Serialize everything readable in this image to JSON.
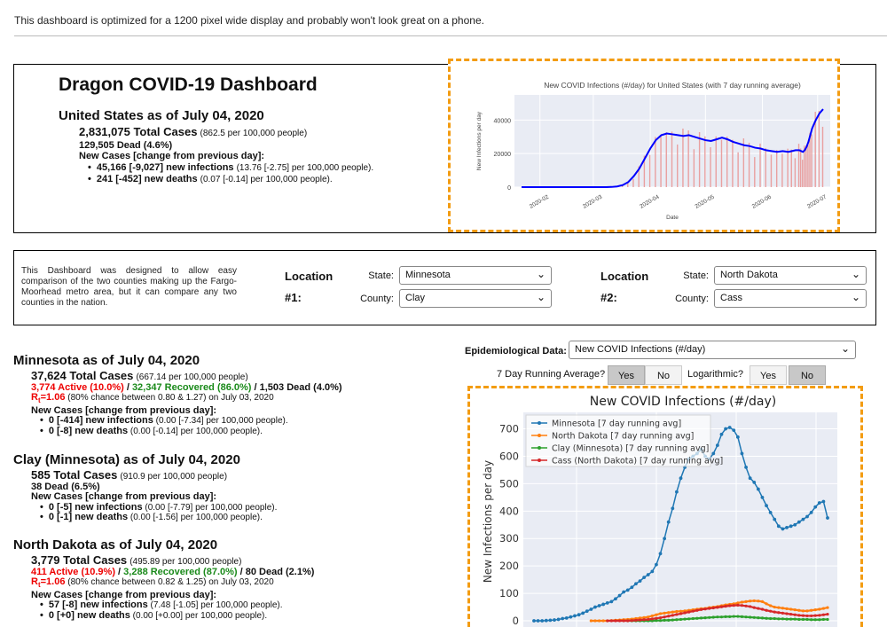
{
  "notice": "This dashboard is optimized for a 1200 pixel wide display and probably won't look great on a phone.",
  "header": {
    "title": "Dragon COVID-19 Dashboard",
    "us_title": "United States as of July 04, 2020",
    "total_cases": "2,831,075 Total Cases",
    "total_cases_rate": "(862.5 per 100,000 people)",
    "dead": "129,505 Dead (4.6%)",
    "new_cases_heading": "New Cases [change from previous day]:",
    "infections_bold": "45,166 [-9,027] new infections",
    "infections_rate": "(13.76 [-2.75] per 100,000 people).",
    "deaths_bold": "241 [-452] new deaths",
    "deaths_rate": "(0.07 [-0.14] per 100,000 people)."
  },
  "us_chart": {
    "title": "New COVID Infections (#/day) for United States (with 7 day running average)",
    "ylabel": "New Infections per day",
    "xlabel": "Date",
    "yticks": [
      "0",
      "20000",
      "40000"
    ],
    "xticks": [
      "2020-02",
      "2020-03",
      "2020-04",
      "2020-05",
      "2020-06",
      "2020-07"
    ]
  },
  "location": {
    "description": "This Dashboard was designed to allow easy comparison of the two counties making up the Fargo-Moorhead metro area, but it can compare any two counties in the nation.",
    "loc1_word": "Location",
    "loc1_num": "#1:",
    "loc2_word": "Location",
    "loc2_num": "#2:",
    "state_label": "State:",
    "county_label": "County:",
    "state1": "Minnesota",
    "county1": "Clay",
    "state2": "North Dakota",
    "county2": "Cass"
  },
  "regions": {
    "mn": {
      "title": "Minnesota as of July 04, 2020",
      "total": "37,624 Total Cases",
      "total_rate": "(667.14 per 100,000 people)",
      "active": "3,774 Active (10.0%)",
      "sep1": " / ",
      "recovered": "32,347 Recovered (86.0%)",
      "dead": " / 1,503 Dead (4.0%)",
      "rt_label": "R",
      "rt_sub": "t",
      "rt_val": "=1.06",
      "rt_desc": " (80% chance between 0.80 & 1.27) on July 03, 2020",
      "new_heading": "New Cases [change from previous day]:",
      "inf_bold": "0 [-414] new infections",
      "inf_rate": " (0.00 [-7.34] per 100,000 people).",
      "death_bold": "0 [-8] new deaths",
      "death_rate": " (0.00 [-0.14] per 100,000 people)."
    },
    "clay": {
      "title": "Clay (Minnesota) as of July 04, 2020",
      "total": "585 Total Cases",
      "total_rate": "(910.9 per 100,000 people)",
      "dead": "38 Dead (6.5%)",
      "new_heading": "New Cases [change from previous day]:",
      "inf_bold": "0 [-5] new infections",
      "inf_rate": " (0.00 [-7.79] per 100,000 people).",
      "death_bold": "0 [-1] new deaths",
      "death_rate": " (0.00 [-1.56] per 100,000 people)."
    },
    "nd": {
      "title": "North Dakota as of July 04, 2020",
      "total": "3,779 Total Cases",
      "total_rate": "(495.89 per 100,000 people)",
      "active": "411 Active (10.9%)",
      "sep1": " / ",
      "recovered": "3,288 Recovered (87.0%)",
      "dead": " / 80 Dead (2.1%)",
      "rt_label": "R",
      "rt_sub": "t",
      "rt_val": "=1.06",
      "rt_desc": " (80% chance between 0.82 & 1.25) on July 03, 2020",
      "new_heading": "New Cases [change from previous day]:",
      "inf_bold": "57 [-8] new infections",
      "inf_rate": " (7.48 [-1.05] per 100,000 people).",
      "death_bold": "0 [+0] new deaths",
      "death_rate": " (0.00 [+0.00] per 100,000 people)."
    }
  },
  "controls": {
    "epi_label": "Epidemiological Data:",
    "epi_value": "New COVID Infections (#/day)",
    "running_avg_label": "7 Day Running Average?",
    "log_label": "Logarithmic?",
    "yes": "Yes",
    "no": "No"
  },
  "colors": {
    "accent_border": "#f39c12",
    "mn": "#1f77b4",
    "nd": "#ff7f0e",
    "clay": "#2ca02c",
    "cass": "#d62728"
  },
  "chart_data": [
    {
      "type": "bar",
      "title": "New COVID Infections (#/day) for United States (with 7 day running average)",
      "xlabel": "Date",
      "ylabel": "New Infections per day",
      "ylim": [
        0,
        55000
      ],
      "x_range": [
        "2020-01-22",
        "2020-07-04"
      ],
      "series": [
        {
          "type": "line",
          "values": [
            0,
            0,
            0,
            0,
            0,
            0,
            0,
            10,
            30,
            100,
            400,
            1200,
            3000,
            6500,
            11000,
            17000,
            23000,
            28000,
            31000,
            32000,
            31500,
            31000,
            30500,
            31000,
            30000,
            29000,
            28000,
            27500,
            28500,
            29500,
            28500,
            27000,
            26000,
            25000,
            24500,
            23500,
            23000,
            22000,
            21500,
            21000,
            21500,
            21000,
            21500,
            22000,
            22000,
            21500,
            21000,
            22000,
            24000,
            27000,
            31000,
            35000,
            40000,
            44000,
            46500
          ],
          "x": [
            "2020-01-22",
            "2020-01-29",
            "2020-02-05",
            "2020-02-12",
            "2020-02-19",
            "2020-02-26",
            "2020-03-01",
            "2020-03-05",
            "2020-03-08",
            "2020-03-11",
            "2020-03-14",
            "2020-03-17",
            "2020-03-20",
            "2020-03-23",
            "2020-03-26",
            "2020-03-29",
            "2020-04-01",
            "2020-04-04",
            "2020-04-07",
            "2020-04-10",
            "2020-04-13",
            "2020-04-16",
            "2020-04-19",
            "2020-04-22",
            "2020-04-25",
            "2020-04-28",
            "2020-05-01",
            "2020-05-04",
            "2020-05-07",
            "2020-05-10",
            "2020-05-13",
            "2020-05-16",
            "2020-05-19",
            "2020-05-22",
            "2020-05-25",
            "2020-05-28",
            "2020-05-31",
            "2020-06-03",
            "2020-06-06",
            "2020-06-09",
            "2020-06-12",
            "2020-06-15",
            "2020-06-17",
            "2020-06-19",
            "2020-06-21",
            "2020-06-22",
            "2020-06-23",
            "2020-06-24",
            "2020-06-25",
            "2020-06-26",
            "2020-06-27",
            "2020-06-28",
            "2020-06-30",
            "2020-07-02",
            "2020-07-04"
          ]
        }
      ]
    },
    {
      "type": "line",
      "title": "New COVID Infections (#/day)",
      "ylabel": "New Infections per day",
      "ylim": [
        0,
        760
      ],
      "yticks": [
        0,
        100,
        200,
        300,
        400,
        500,
        600,
        700
      ],
      "legend": "top-left",
      "series": [
        {
          "name": "Minnesota [7 day running avg]",
          "values": [
            0,
            0,
            0,
            1,
            2,
            3,
            5,
            8,
            10,
            14,
            18,
            22,
            28,
            35,
            42,
            50,
            55,
            60,
            65,
            70,
            80,
            92,
            105,
            112,
            122,
            135,
            145,
            158,
            168,
            180,
            205,
            245,
            300,
            360,
            410,
            470,
            520,
            560,
            590,
            600,
            610,
            625,
            600,
            590,
            610,
            640,
            680,
            700,
            705,
            695,
            670,
            610,
            560,
            520,
            505,
            480,
            450,
            420,
            395,
            370,
            345,
            335,
            340,
            345,
            350,
            360,
            370,
            380,
            395,
            415,
            430,
            435,
            375
          ]
        },
        {
          "name": "North Dakota [7 day running avg]",
          "values": [
            0,
            0,
            0,
            0,
            0,
            1,
            2,
            3,
            4,
            5,
            6,
            8,
            10,
            12,
            14,
            18,
            22,
            26,
            28,
            30,
            32,
            34,
            35,
            36,
            38,
            40,
            42,
            44,
            45,
            48,
            50,
            52,
            55,
            58,
            60,
            62,
            65,
            68,
            70,
            72,
            73,
            72,
            70,
            62,
            55,
            50,
            48,
            46,
            44,
            42,
            40,
            38,
            36,
            36,
            38,
            40,
            42,
            45,
            48
          ]
        },
        {
          "name": "Clay (Minnesota) [7 day running avg]",
          "values": [
            0,
            0,
            0,
            0,
            0,
            0,
            0,
            1,
            1,
            2,
            2,
            3,
            4,
            5,
            6,
            7,
            8,
            9,
            10,
            11,
            12,
            13,
            14,
            14,
            15,
            15,
            16,
            16,
            15,
            14,
            13,
            12,
            11,
            10,
            9,
            8,
            8,
            7,
            7,
            6,
            6,
            6,
            5,
            5,
            5,
            4,
            4,
            4,
            5,
            5
          ]
        },
        {
          "name": "Cass (North Dakota) [7 day running avg]",
          "values": [
            0,
            0,
            0,
            0,
            0,
            0,
            1,
            2,
            3,
            4,
            5,
            7,
            9,
            11,
            14,
            17,
            20,
            23,
            26,
            29,
            32,
            35,
            38,
            41,
            43,
            45,
            47,
            49,
            51,
            53,
            55,
            56,
            57,
            56,
            54,
            52,
            48,
            45,
            42,
            38,
            35,
            32,
            30,
            28,
            26,
            24,
            22,
            20,
            19,
            18,
            18,
            19,
            20,
            22,
            24
          ]
        }
      ]
    }
  ]
}
